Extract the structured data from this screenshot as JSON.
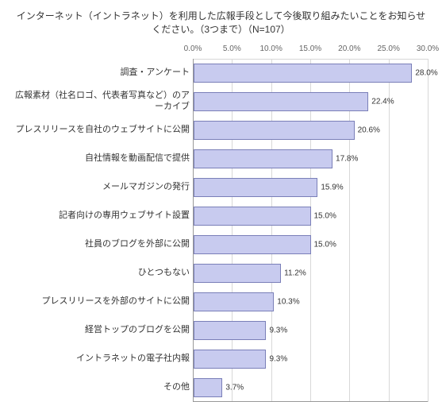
{
  "chart_data": {
    "type": "bar",
    "title": "インターネット（イントラネット）を利用した広報手段として今後取り組みたいことをお知らせください。（3つまで）（N=107）",
    "xlabel": "",
    "ylabel": "",
    "xlim": [
      0,
      30
    ],
    "xticks": [
      0,
      5,
      10,
      15,
      20,
      25,
      30
    ],
    "xtick_labels": [
      "0.0%",
      "5.0%",
      "10.0%",
      "15.0%",
      "20.0%",
      "25.0%",
      "30.0%"
    ],
    "categories": [
      "調査・アンケート",
      "広報素材（社名ロゴ、代表者写真など）のアーカイブ",
      "プレスリリースを自社のウェブサイトに公開",
      "自社情報を動画配信で提供",
      "メールマガジンの発行",
      "記者向けの専用ウェブサイト設置",
      "社員のブログを外部に公開",
      "ひとつもない",
      "プレスリリースを外部のサイトに公開",
      "経営トップのブログを公開",
      "イントラネットの電子社内報",
      "その他"
    ],
    "values": [
      28.0,
      22.4,
      20.6,
      17.8,
      15.9,
      15.0,
      15.0,
      11.2,
      10.3,
      9.3,
      9.3,
      3.7
    ],
    "value_labels": [
      "28.0%",
      "22.4%",
      "20.6%",
      "17.8%",
      "15.9%",
      "15.0%",
      "15.0%",
      "11.2%",
      "10.3%",
      "9.3%",
      "9.3%",
      "3.7%"
    ],
    "bar_color": "#c8cbef",
    "bar_border": "#7a7fb8"
  }
}
